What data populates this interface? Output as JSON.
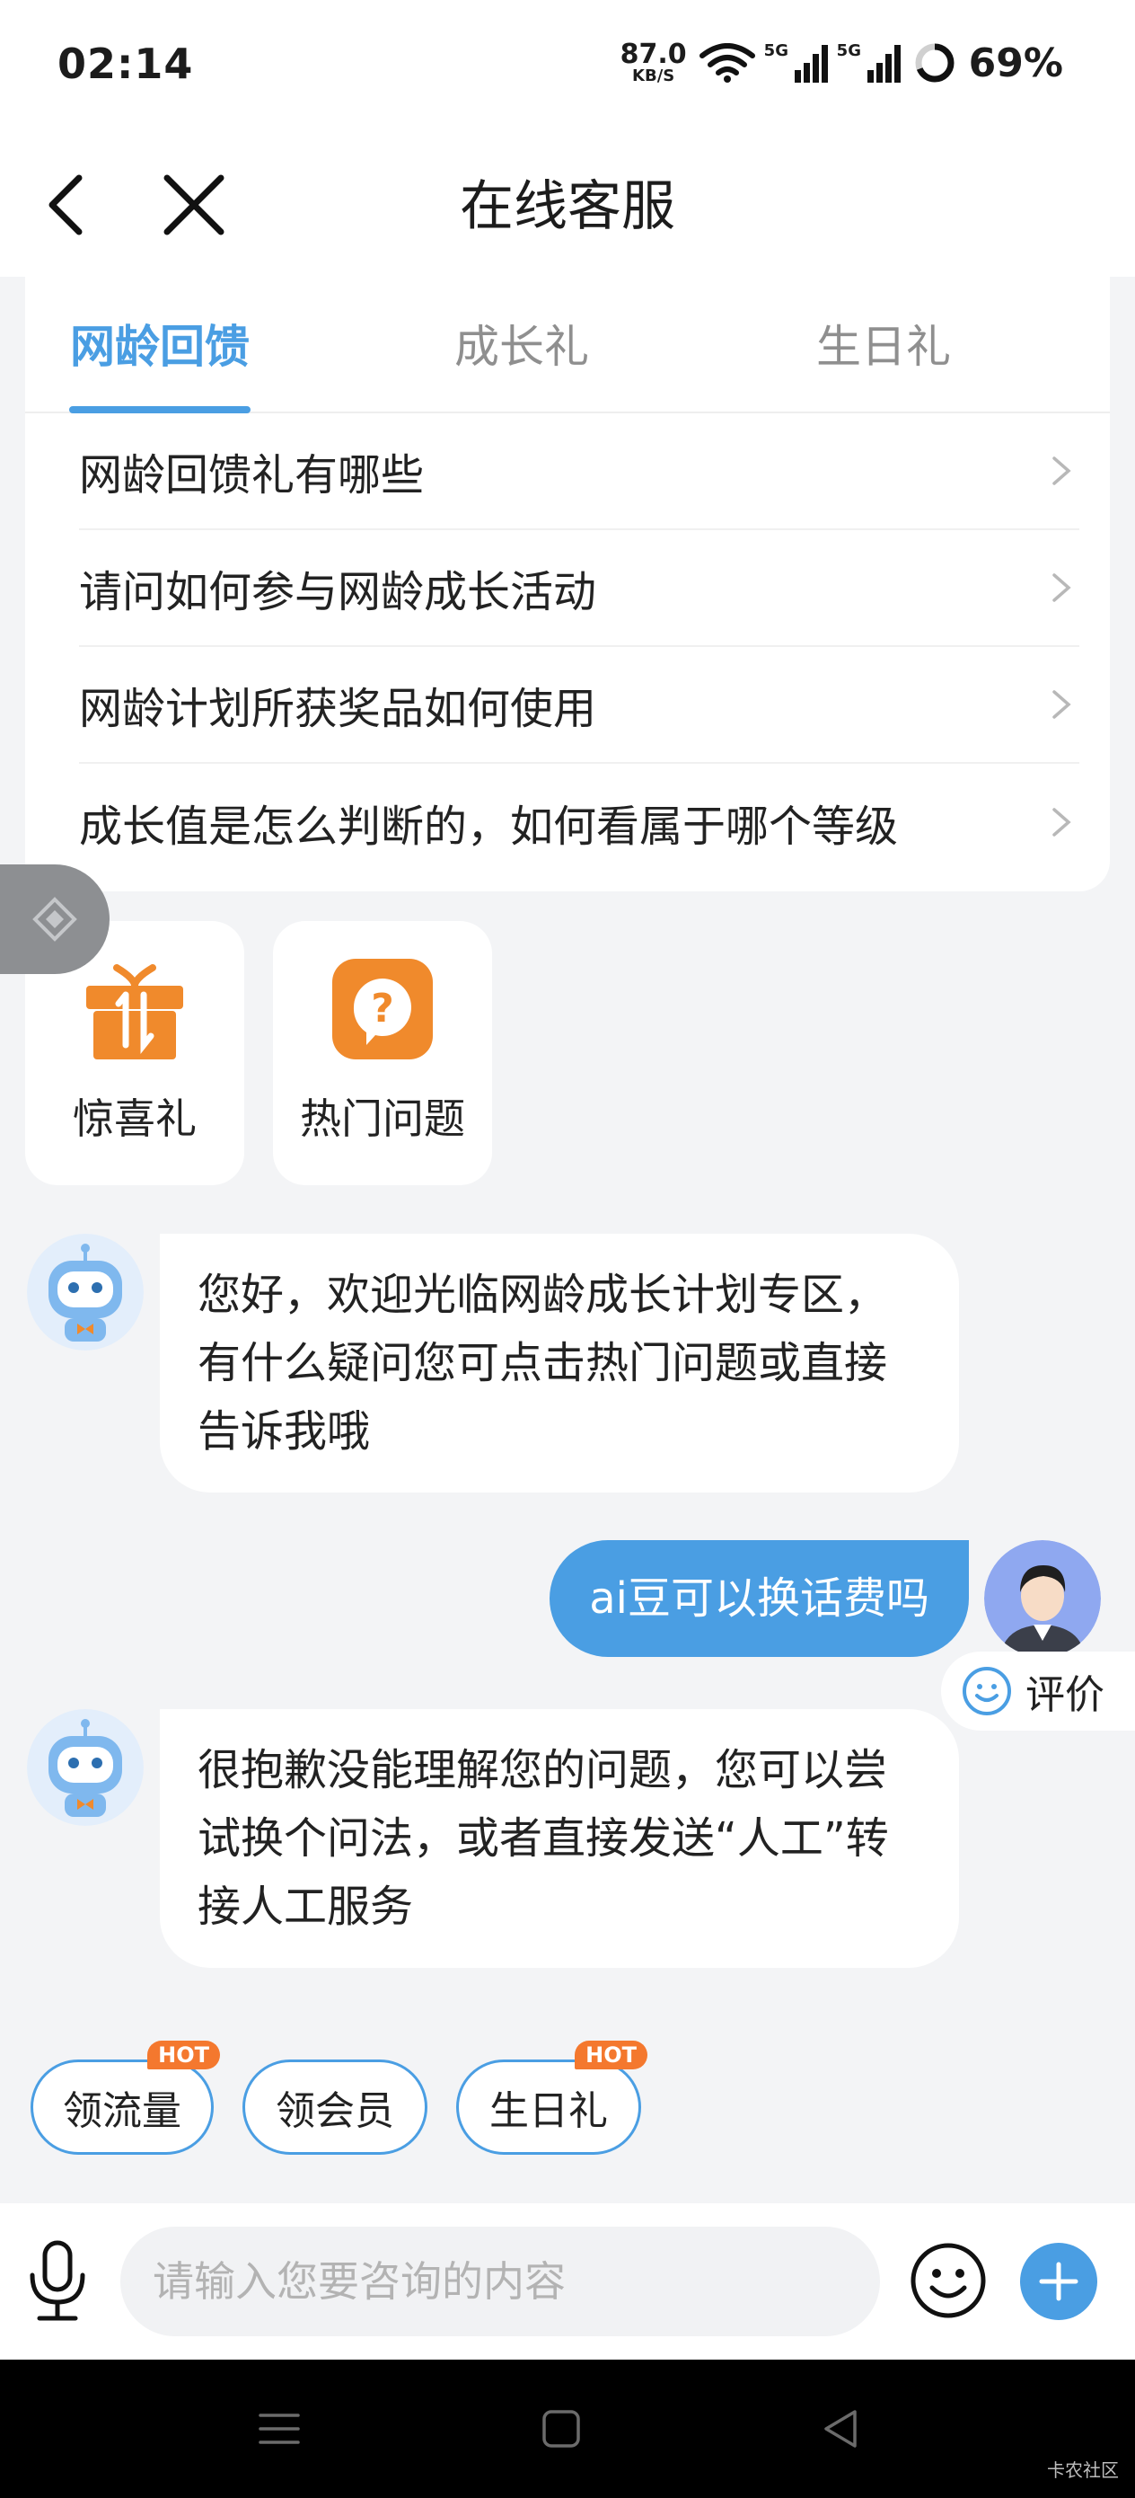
{
  "status_bar": {
    "time": "02:14",
    "net_speed_value": "87.0",
    "net_speed_unit": "KB/S",
    "signal_1_label": "5G",
    "signal_2_label": "5G",
    "battery": "69%"
  },
  "nav": {
    "title": "在线客服",
    "back_icon": "chevron-left-icon",
    "close_icon": "close-icon"
  },
  "faq": {
    "tabs": [
      {
        "label": "网龄回馈",
        "active": true
      },
      {
        "label": "成长礼",
        "active": false
      },
      {
        "label": "生日礼",
        "active": false
      }
    ],
    "items": [
      "网龄回馈礼有哪些",
      "请问如何参与网龄成长活动",
      "网龄计划所获奖品如何使用",
      "成长值是怎么判断的，如何看属于哪个等级"
    ]
  },
  "quick_entries": [
    {
      "label": "惊喜礼",
      "icon": "gift-icon"
    },
    {
      "label": "热门问题",
      "icon": "question-bubble-icon"
    }
  ],
  "messages": [
    {
      "from": "bot",
      "text": "您好，欢迎光临网龄成长计划专区，有什么疑问您可点击热门问题或直接告诉我哦"
    },
    {
      "from": "user",
      "text": "ai豆可以换话费吗"
    },
    {
      "from": "bot",
      "text": "很抱歉没能理解您的问题，您可以尝试换个问法，或者直接发送“人工”转接人工服务"
    }
  ],
  "rate_button": {
    "label": "评价"
  },
  "chips": [
    {
      "label": "领流量",
      "badge": "HOT"
    },
    {
      "label": "领会员",
      "badge": ""
    },
    {
      "label": "生日礼",
      "badge": "HOT"
    }
  ],
  "input": {
    "placeholder": "请输入您要咨询的内容",
    "value": ""
  },
  "watermark": "卡农社区",
  "colors": {
    "accent": "#4a9ee3",
    "hot_badge": "#f4782e",
    "gift_orange": "#f08a2c"
  }
}
